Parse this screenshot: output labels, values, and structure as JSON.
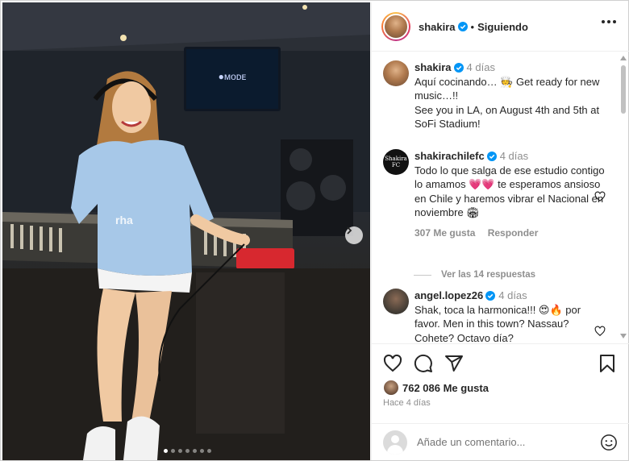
{
  "post": {
    "username": "shakira",
    "separator": "•",
    "follow_status": "Siguiendo",
    "image_dots": 7,
    "image_active_dot": 0,
    "screen_text": "●ᴍᴏᴅᴇ"
  },
  "comments": [
    {
      "username": "shakira",
      "time": "4 días",
      "text": "Aquí cocinando… 🧑‍🍳 Get ready for new music…!!\nSee you in LA, on August 4th and 5th at SoFi Stadium!",
      "likes": "",
      "reply": ""
    },
    {
      "username": "shakirachilefc",
      "time": "4 días",
      "text": "Todo lo que salga de ese estudio contigo lo amamos 💗💗 te esperamos ansioso en Chile y haremos vibrar el Nacional en noviembre 🏟",
      "likes": "307 Me gusta",
      "reply": "Responder",
      "avatar_text": "Shakira FC"
    },
    {
      "username": "angel.lopez26",
      "time": "4 días",
      "text": "Shak, toca la harmonica!!! 😍🔥 por favor. Men in this town? Nassau? Cohete? Octavo día?",
      "likes": "",
      "reply": ""
    }
  ],
  "view_replies": "Ver las 14 respuestas",
  "likes_count": "762 086 Me gusta",
  "time_ago": "Hace 4 días",
  "comment_placeholder": "Añade un comentario...",
  "colors": {
    "verified": "#0095f6",
    "heart_pink": "#e4405f",
    "text": "#262626",
    "muted": "#8e8e8e"
  },
  "icons": [
    "verified-icon",
    "more-icon",
    "heart-icon",
    "comment-icon",
    "share-icon",
    "bookmark-icon",
    "emoji-icon",
    "chevron-right-icon"
  ]
}
